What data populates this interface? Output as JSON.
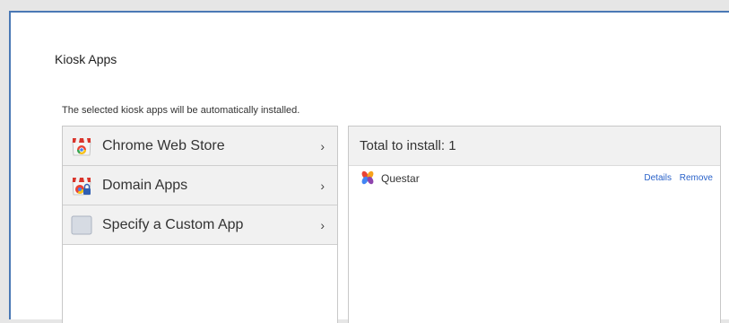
{
  "dialog": {
    "title": "Kiosk Apps",
    "description": "The selected kiosk apps will be automatically installed."
  },
  "sources": [
    {
      "label": "Chrome Web Store",
      "icon": "chrome-web-store-icon"
    },
    {
      "label": "Domain Apps",
      "icon": "domain-apps-icon"
    },
    {
      "label": "Specify a Custom App",
      "icon": "custom-app-icon"
    }
  ],
  "chevron": "›",
  "install": {
    "header": "Total to install: 1",
    "apps": [
      {
        "name": "Questar",
        "icon": "questar-icon",
        "details_label": "Details",
        "remove_label": "Remove"
      }
    ]
  },
  "colors": {
    "accent_border": "#4a78b5",
    "link": "#2a62c9"
  }
}
